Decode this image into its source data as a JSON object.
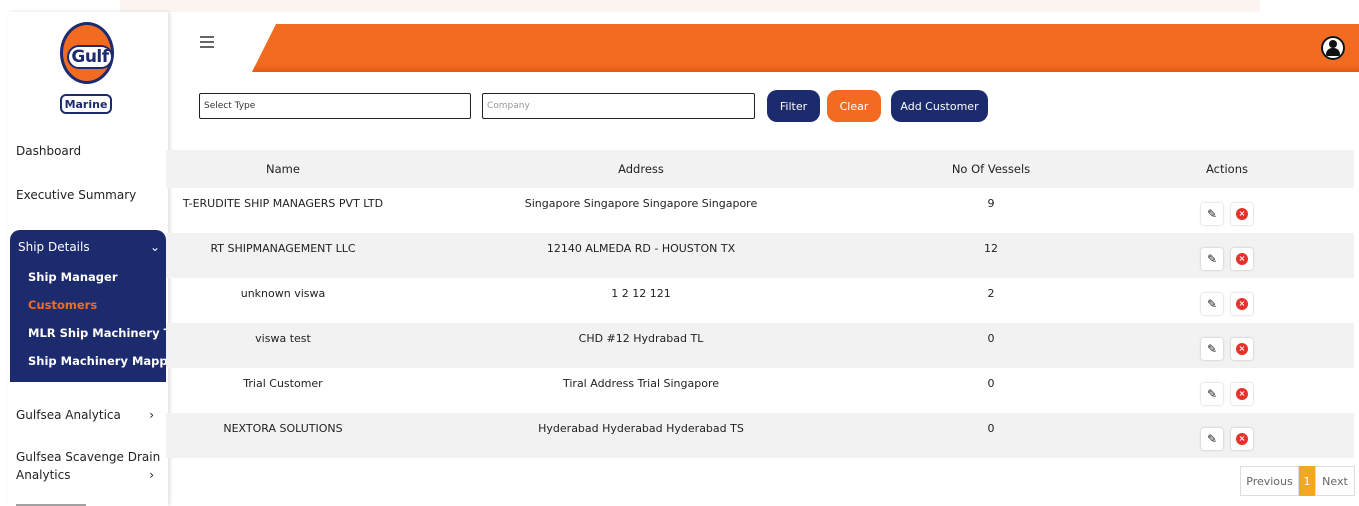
{
  "brand": {
    "logo_text": "Gulf",
    "logo_subtext": "Marine"
  },
  "sidebar": {
    "dashboard": "Dashboard",
    "executive_summary": "Executive Summary",
    "ship_details": "Ship Details",
    "ship_details_chevron": "⌄",
    "sub_items": {
      "ship_manager": "Ship Manager",
      "customers": "Customers",
      "mlr_tags": "MLR Ship Machinery Tags",
      "mappings": "Ship Machinery Mappings"
    },
    "gulfsea_analytica": "Gulfsea Analytica",
    "scavenge_line1": "Gulfsea Scavenge Drain",
    "scavenge_line2": "Analytics",
    "chevron_right": "›"
  },
  "filters": {
    "type_placeholder": "Select Type",
    "company_placeholder": "Company",
    "filter_label": "Filter",
    "clear_label": "Clear",
    "add_label": "Add Customer"
  },
  "table": {
    "headers": {
      "name": "Name",
      "address": "Address",
      "vessels": "No Of Vessels",
      "actions": "Actions"
    },
    "rows": [
      {
        "name": "T-ERUDITE SHIP MANAGERS PVT LTD",
        "address": "Singapore Singapore Singapore Singapore",
        "vessels": "9"
      },
      {
        "name": "RT SHIPMANAGEMENT LLC",
        "address": "12140 ALMEDA RD - HOUSTON TX",
        "vessels": "12"
      },
      {
        "name": "unknown viswa",
        "address": "1 2 12 121",
        "vessels": "2"
      },
      {
        "name": "viswa test",
        "address": "CHD #12 Hydrabad TL",
        "vessels": "0"
      },
      {
        "name": "Trial Customer",
        "address": "Tiral Address Trial Singapore",
        "vessels": "0"
      },
      {
        "name": "NEXTORA SOLUTIONS",
        "address": "Hyderabad Hyderabad Hyderabad TS",
        "vessels": "0"
      }
    ],
    "edit_glyph": "✎",
    "delete_glyph": "×"
  },
  "pagination": {
    "previous": "Previous",
    "current": "1",
    "next": "Next"
  },
  "colors": {
    "navy": "#1c2a6e",
    "orange": "#f26b21",
    "page_active": "#f5a623",
    "delete_red": "#e8312a"
  }
}
